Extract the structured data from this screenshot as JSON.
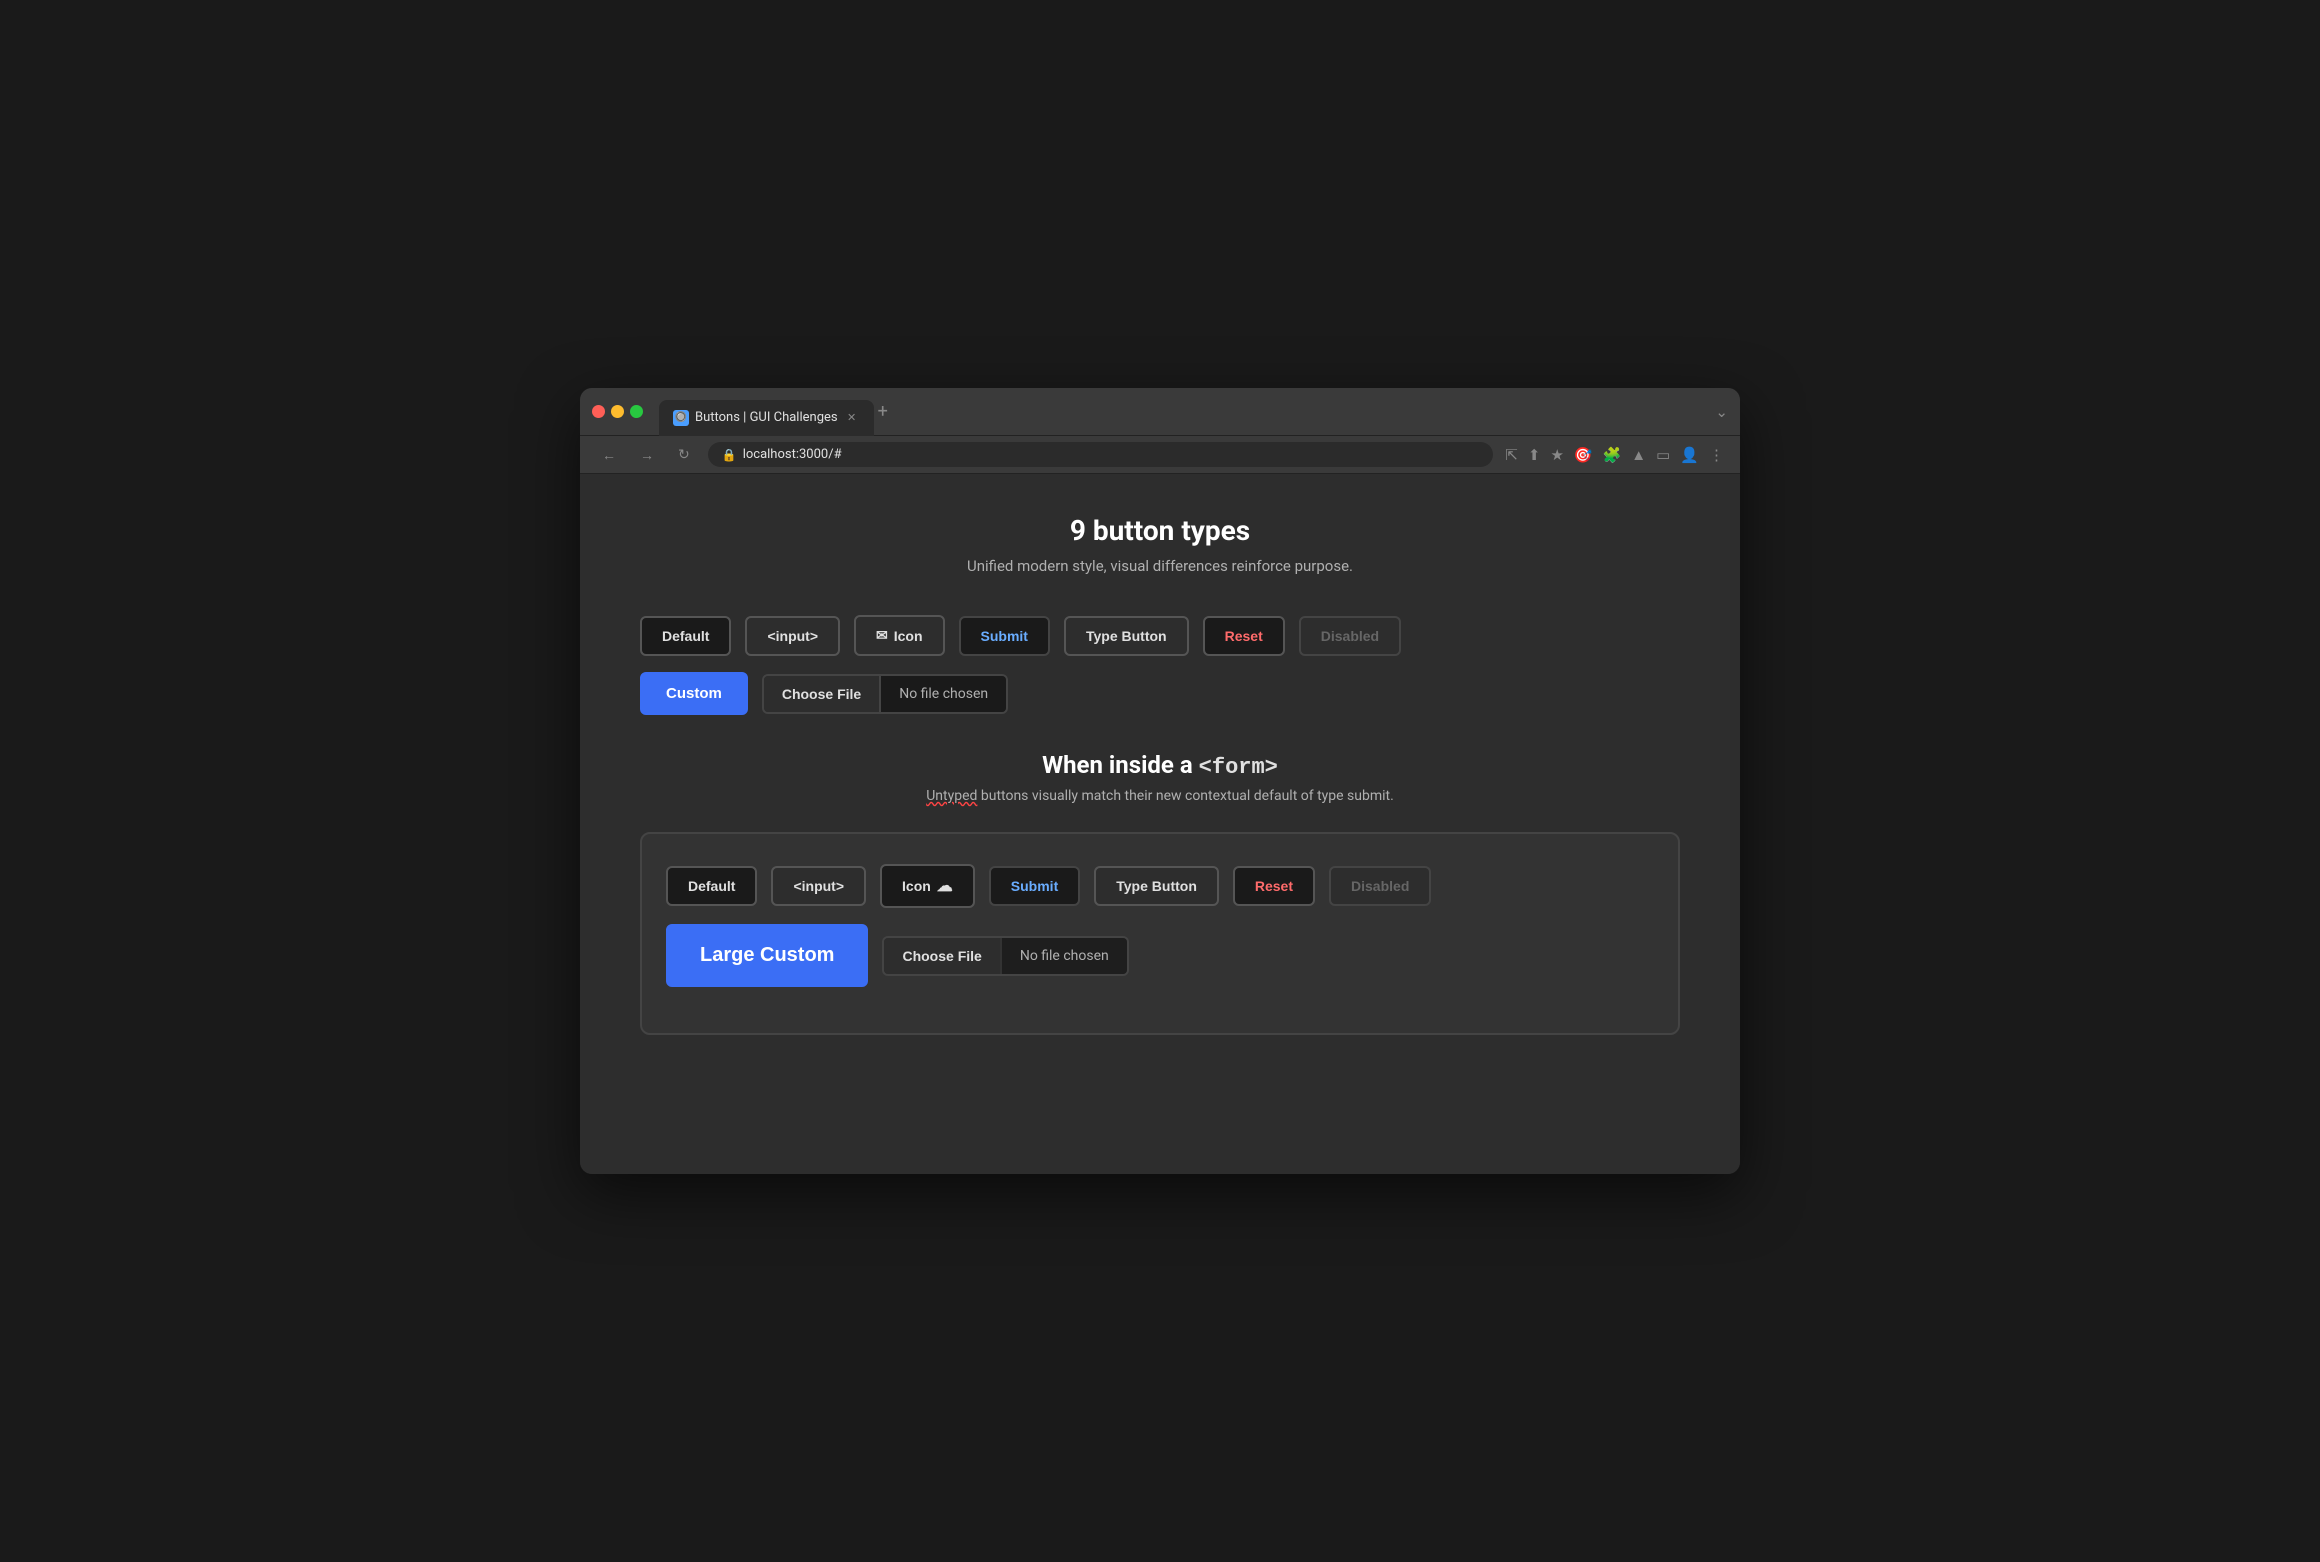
{
  "browser": {
    "tab_title": "Buttons | GUI Challenges",
    "url": "localhost:3000/#",
    "new_tab_label": "+"
  },
  "page": {
    "title": "9 button types",
    "subtitle": "Unified modern style, visual differences reinforce purpose."
  },
  "top_buttons": {
    "default_label": "Default",
    "input_label": "<input>",
    "icon_label": "Icon",
    "submit_label": "Submit",
    "type_button_label": "Type Button",
    "reset_label": "Reset",
    "disabled_label": "Disabled"
  },
  "custom_row": {
    "custom_label": "Custom",
    "choose_file_label": "Choose File",
    "no_file_label": "No file chosen"
  },
  "form_section": {
    "title": "When inside a ",
    "title_code": "<form>",
    "subtitle_plain": " buttons visually match their new contextual default of type submit.",
    "subtitle_underlined": "Untyped",
    "default_label": "Default",
    "input_label": "<input>",
    "icon_label": "Icon",
    "submit_label": "Submit",
    "type_button_label": "Type Button",
    "reset_label": "Reset",
    "disabled_label": "Disabled",
    "large_custom_label": "Large Custom",
    "choose_file_label": "Choose File",
    "no_file_label": "No file chosen"
  },
  "icons": {
    "email_icon": "✉",
    "cloud_icon": "☁"
  }
}
